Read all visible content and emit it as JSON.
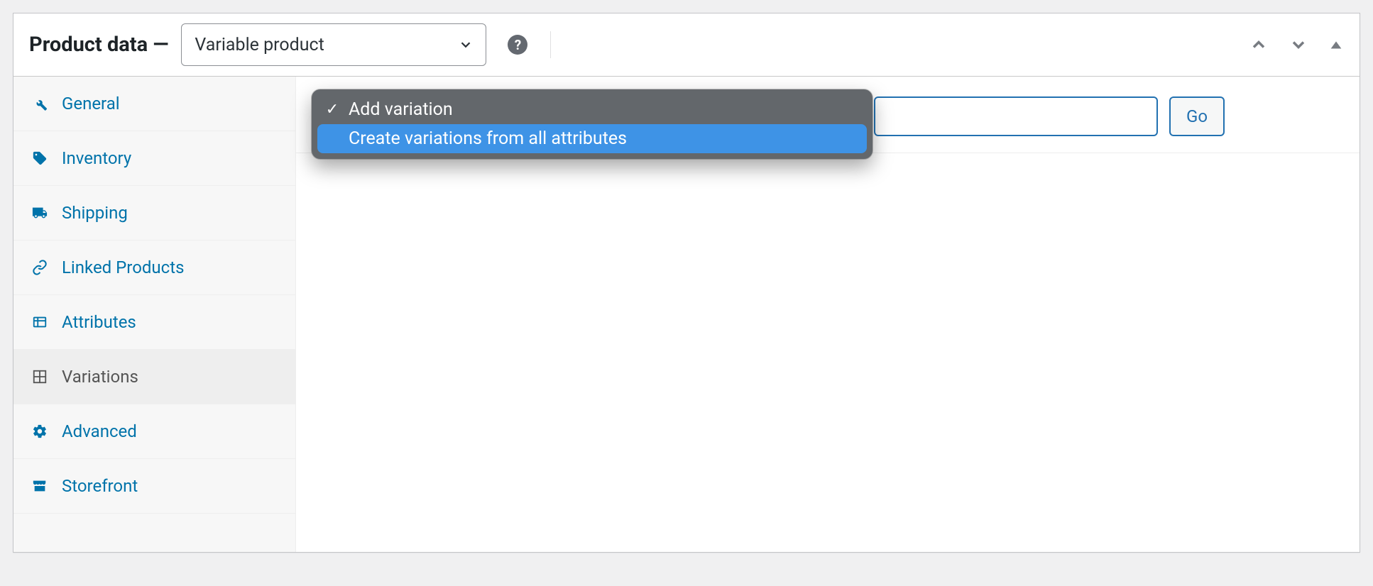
{
  "panel": {
    "title": "Product data —",
    "product_type_selected": "Variable product"
  },
  "tabs": [
    {
      "key": "general",
      "label": "General",
      "icon": "wrench",
      "active": false
    },
    {
      "key": "inventory",
      "label": "Inventory",
      "icon": "tag",
      "active": false
    },
    {
      "key": "shipping",
      "label": "Shipping",
      "icon": "truck",
      "active": false
    },
    {
      "key": "linked",
      "label": "Linked Products",
      "icon": "link",
      "active": false
    },
    {
      "key": "attributes",
      "label": "Attributes",
      "icon": "list",
      "active": false
    },
    {
      "key": "variations",
      "label": "Variations",
      "icon": "grid",
      "active": true
    },
    {
      "key": "advanced",
      "label": "Advanced",
      "icon": "gear",
      "active": false
    },
    {
      "key": "storefront",
      "label": "Storefront",
      "icon": "store",
      "active": false
    }
  ],
  "variation_dropdown": {
    "options": [
      {
        "label": "Add variation",
        "selected": true,
        "highlighted": false
      },
      {
        "label": "Create variations from all attributes",
        "selected": false,
        "highlighted": true
      }
    ]
  },
  "buttons": {
    "go": "Go"
  }
}
